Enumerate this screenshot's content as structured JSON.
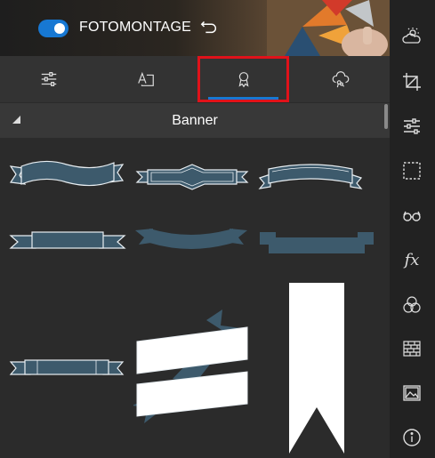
{
  "header": {
    "toggle_on": true,
    "title": "FOTOMONTAGE",
    "undo_icon": "undo-icon"
  },
  "tabs": [
    {
      "name": "adjust-tab",
      "icon": "sliders-icon",
      "selected": false
    },
    {
      "name": "text-tab",
      "icon": "text-icon",
      "selected": false
    },
    {
      "name": "badge-tab",
      "icon": "award-ribbon-icon",
      "selected": true
    },
    {
      "name": "sticker-tab",
      "icon": "cloud-flower-icon",
      "selected": false
    }
  ],
  "section": {
    "label": "Banner"
  },
  "banners": [
    "ribbon-banner-wavy",
    "ribbon-banner-diamond",
    "ribbon-banner-arched",
    "ribbon-banner-flat",
    "ribbon-banner-curved-dark",
    "ribbon-banner-flat-dark",
    "ribbon-banner-thin",
    "ribbon-banner-folded-white",
    "ribbon-bookmark-white"
  ],
  "rightbar": [
    "weather-icon",
    "crop-icon",
    "sliders-icon",
    "selection-icon",
    "glasses-icon",
    "fx-icon",
    "color-circles-icon",
    "brick-wall-icon",
    "image-icon",
    "info-icon"
  ],
  "colors": {
    "accent": "#1778d3",
    "highlight": "#e0121a",
    "banner_fill": "#3d5a6c",
    "banner_stroke": "#e8eef2"
  }
}
